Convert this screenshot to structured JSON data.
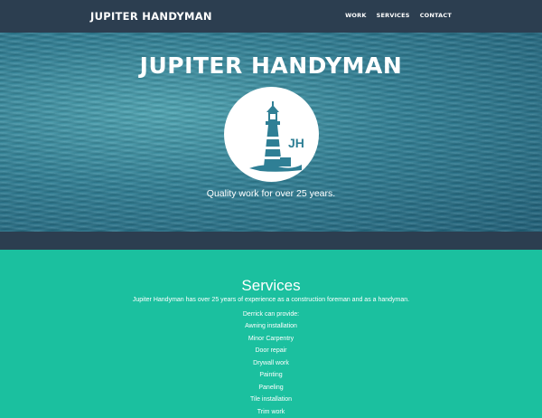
{
  "navbar": {
    "brand": "JUPITER HANDYMAN",
    "links": [
      "WORK",
      "SERVICES",
      "CONTACT"
    ]
  },
  "hero": {
    "title": "JUPITER HANDYMAN",
    "logo_initials": "JH",
    "tagline": "Quality work for over 25 years."
  },
  "services": {
    "title": "Services",
    "intro": "Jupiter Handyman has over 25 years of experience as a construction foreman and as a handyman.",
    "lead": "Derrick can provide:",
    "items": [
      "Awning installation",
      "Minor Carpentry",
      "Door repair",
      "Drywall work",
      "Painting",
      "Paneling",
      "Tile installation",
      "Trim work"
    ]
  },
  "colors": {
    "navbar": "#2c3e50",
    "accent": "#1bc09f",
    "ocean": "#2f7f95",
    "text": "#ffffff"
  },
  "icons": {
    "logo": "lighthouse-icon"
  }
}
